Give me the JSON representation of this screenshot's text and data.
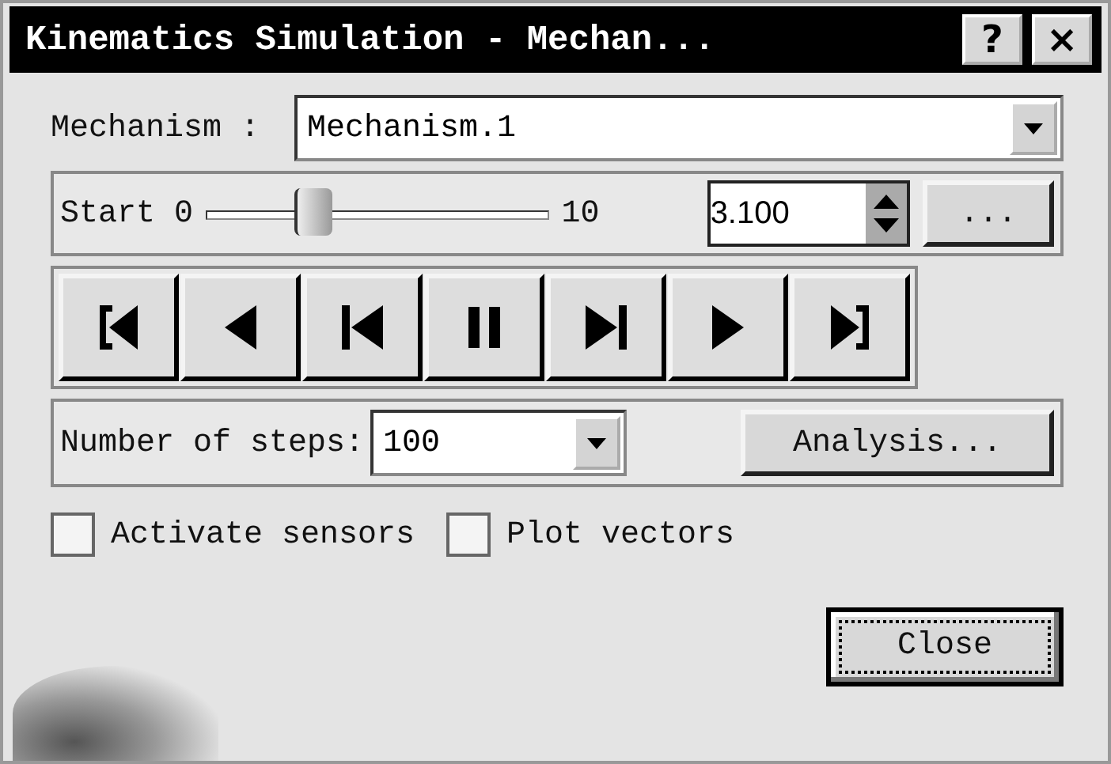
{
  "window": {
    "title": "Kinematics Simulation - Mechan...",
    "help_button": "?",
    "close_button": "×"
  },
  "mechanism": {
    "label": "Mechanism :",
    "value": "Mechanism.1"
  },
  "slider": {
    "start_label": "Start 0",
    "end_label": "10",
    "level": 0.31,
    "value": "3.100",
    "more_button": "..."
  },
  "player_buttons": [
    {
      "kind": "jump-start"
    },
    {
      "kind": "play-backward"
    },
    {
      "kind": "step-backward"
    },
    {
      "kind": "pause"
    },
    {
      "kind": "step-forward"
    },
    {
      "kind": "play-forward"
    },
    {
      "kind": "jump-end"
    }
  ],
  "steps": {
    "label": "Number of steps:",
    "value": "100",
    "analysis_button": "Analysis..."
  },
  "checkboxes": [
    {
      "label": "Activate sensors",
      "checked": false
    },
    {
      "label": "Plot vectors",
      "checked": false
    }
  ],
  "close_button": "Close"
}
